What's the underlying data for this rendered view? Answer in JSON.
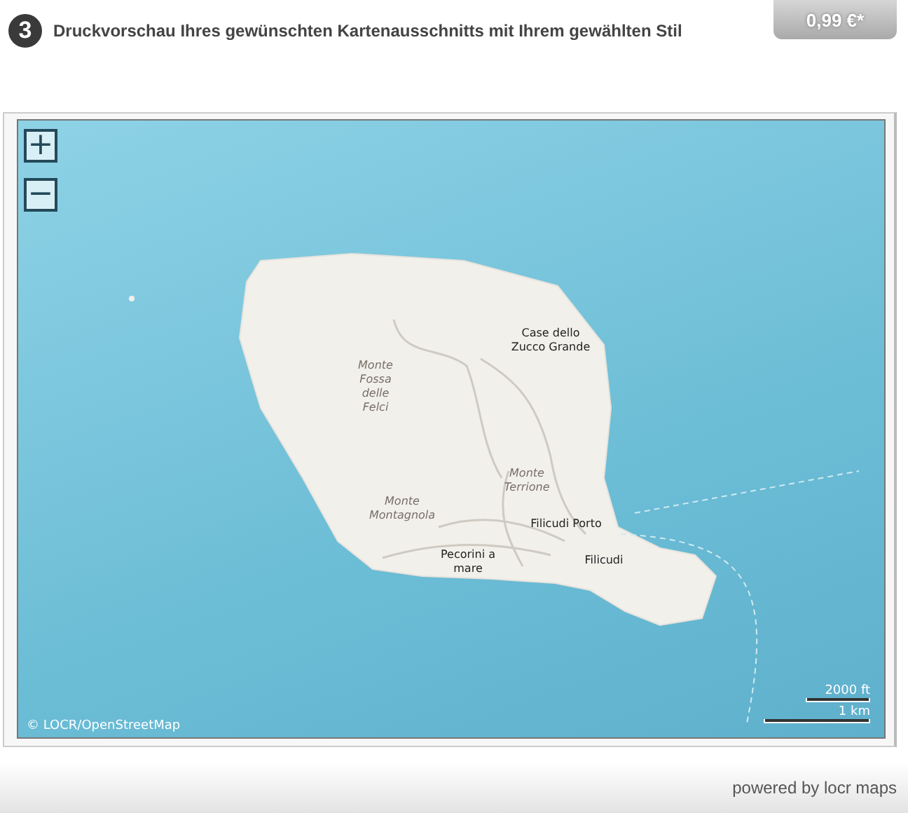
{
  "header": {
    "step": "3",
    "title": "Druckvorschau Ihres gewünschten Kartenausschnitts mit Ihrem gewählten Stil",
    "price": "0,99 €*"
  },
  "map": {
    "zoom_in": "+",
    "zoom_out": "−",
    "labels": [
      {
        "lines": [
          "Case dello",
          "Zucco Grande"
        ],
        "kind": "place"
      },
      {
        "lines": [
          "Monte",
          "Fossa",
          "delle",
          "Felci"
        ],
        "kind": "peak"
      },
      {
        "lines": [
          "Monte",
          "Terrione"
        ],
        "kind": "peak"
      },
      {
        "lines": [
          "Monte",
          "Montagnola"
        ],
        "kind": "peak"
      },
      {
        "lines": [
          "Filicudi Porto"
        ],
        "kind": "place"
      },
      {
        "lines": [
          "Pecorini a",
          "mare"
        ],
        "kind": "place"
      },
      {
        "lines": [
          "Filicudi"
        ],
        "kind": "place"
      }
    ],
    "scale": [
      "2000 ft",
      "1 km"
    ],
    "attribution": "© LOCR/OpenStreetMap"
  },
  "footer": {
    "text": "powered by locr maps"
  }
}
